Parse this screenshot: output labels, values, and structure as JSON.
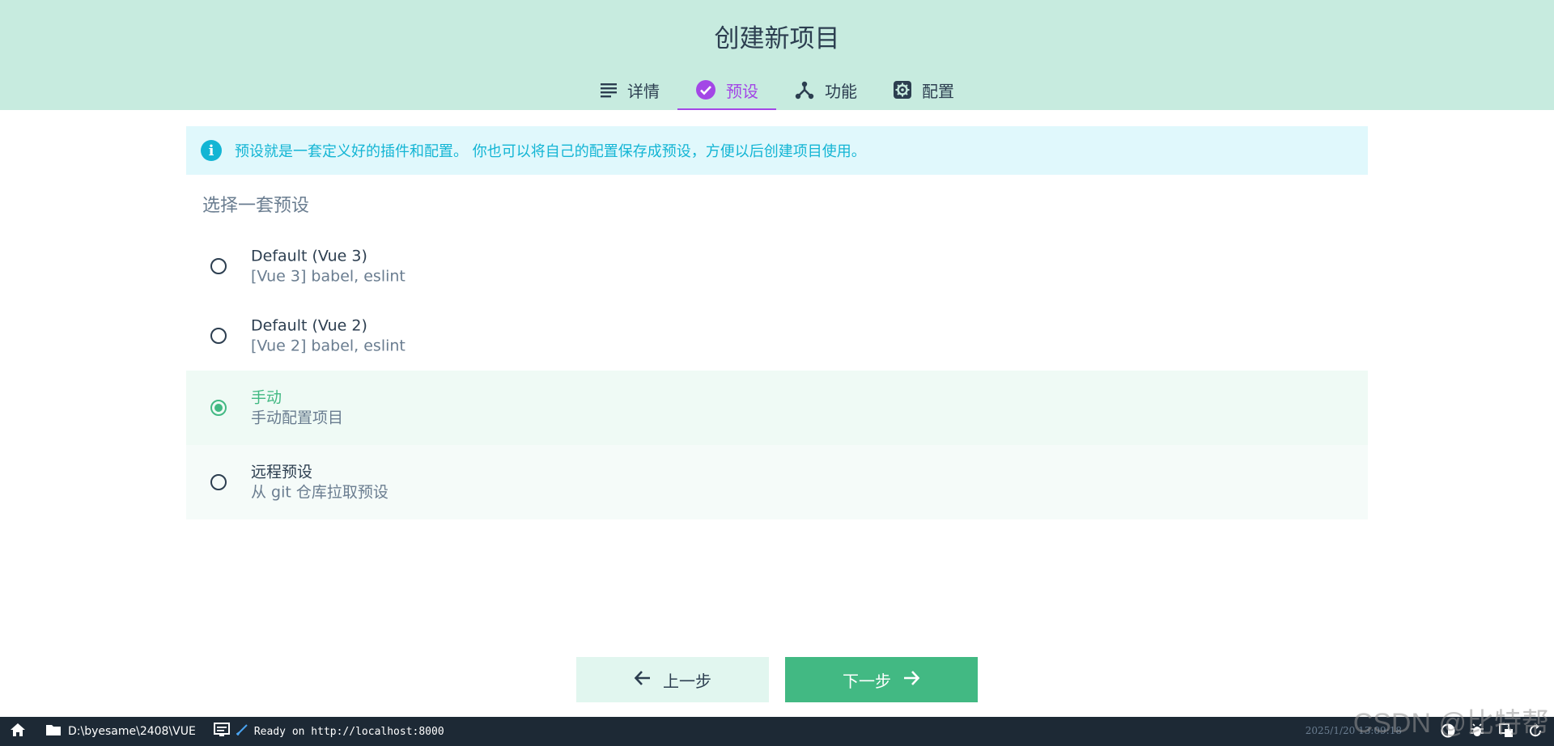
{
  "header": {
    "title": "创建新项目",
    "tabs": [
      {
        "label": "详情",
        "icon": "list-icon"
      },
      {
        "label": "预设",
        "icon": "check-circle-icon",
        "active": true
      },
      {
        "label": "功能",
        "icon": "merge-icon"
      },
      {
        "label": "配置",
        "icon": "gear-icon"
      }
    ]
  },
  "info": {
    "text": "预设就是一套定义好的插件和配置。 你也可以将自己的配置保存成预设，方便以后创建项目使用。",
    "icon": "info-icon"
  },
  "section_title": "选择一套预设",
  "options": [
    {
      "name": "Default (Vue 3)",
      "desc": "[Vue 3] babel, eslint",
      "selected": false
    },
    {
      "name": "Default (Vue 2)",
      "desc": "[Vue 2] babel, eslint",
      "selected": false
    },
    {
      "name": "手动",
      "desc": "手动配置项目",
      "selected": true
    },
    {
      "name": "远程预设",
      "desc": "从 git 仓库拉取预设",
      "selected": false
    }
  ],
  "buttons": {
    "prev_label": "上一步",
    "next_label": "下一步"
  },
  "statusbar": {
    "path": "D:\\byesame\\2408\\VUE",
    "log": "Ready on http://localhost:8000",
    "time": "2025/1/20 13:09:18"
  },
  "watermark": "CSDN @比特帮",
  "colors": {
    "header_bg": "#c7ebdf",
    "accent_purple": "#a347e6",
    "accent_green": "#42b983",
    "info_blue": "#13b5d4",
    "statusbar_bg": "#1d2935"
  }
}
